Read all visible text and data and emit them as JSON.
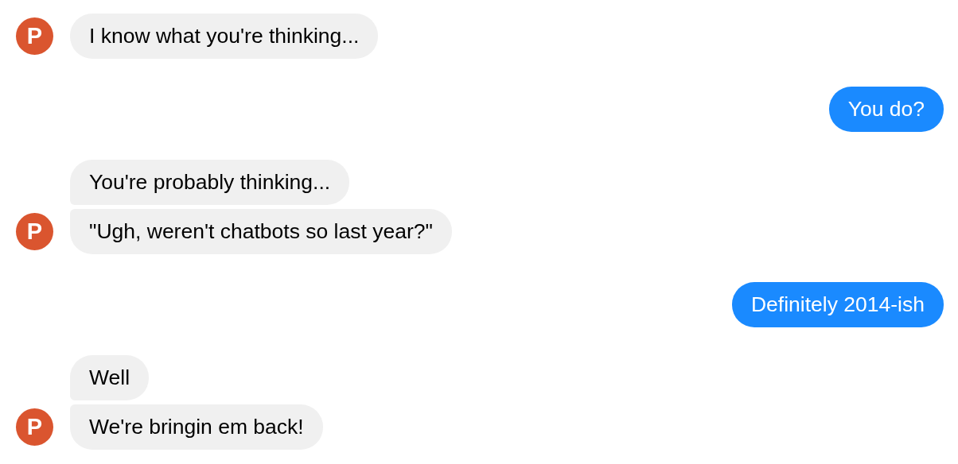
{
  "messages": [
    {
      "kind": "bot",
      "avatar": "P",
      "bubbles": [
        "I know what you're thinking..."
      ]
    },
    {
      "kind": "user",
      "bubbles": [
        "You do?"
      ]
    },
    {
      "kind": "bot",
      "avatar": "P",
      "bubbles": [
        "You're probably thinking...",
        "\"Ugh, weren't chatbots so last year?\""
      ]
    },
    {
      "kind": "user",
      "bubbles": [
        "Definitely 2014-ish"
      ]
    },
    {
      "kind": "bot",
      "avatar": "P",
      "bubbles": [
        "Well",
        "We're bringin em back!"
      ]
    }
  ]
}
